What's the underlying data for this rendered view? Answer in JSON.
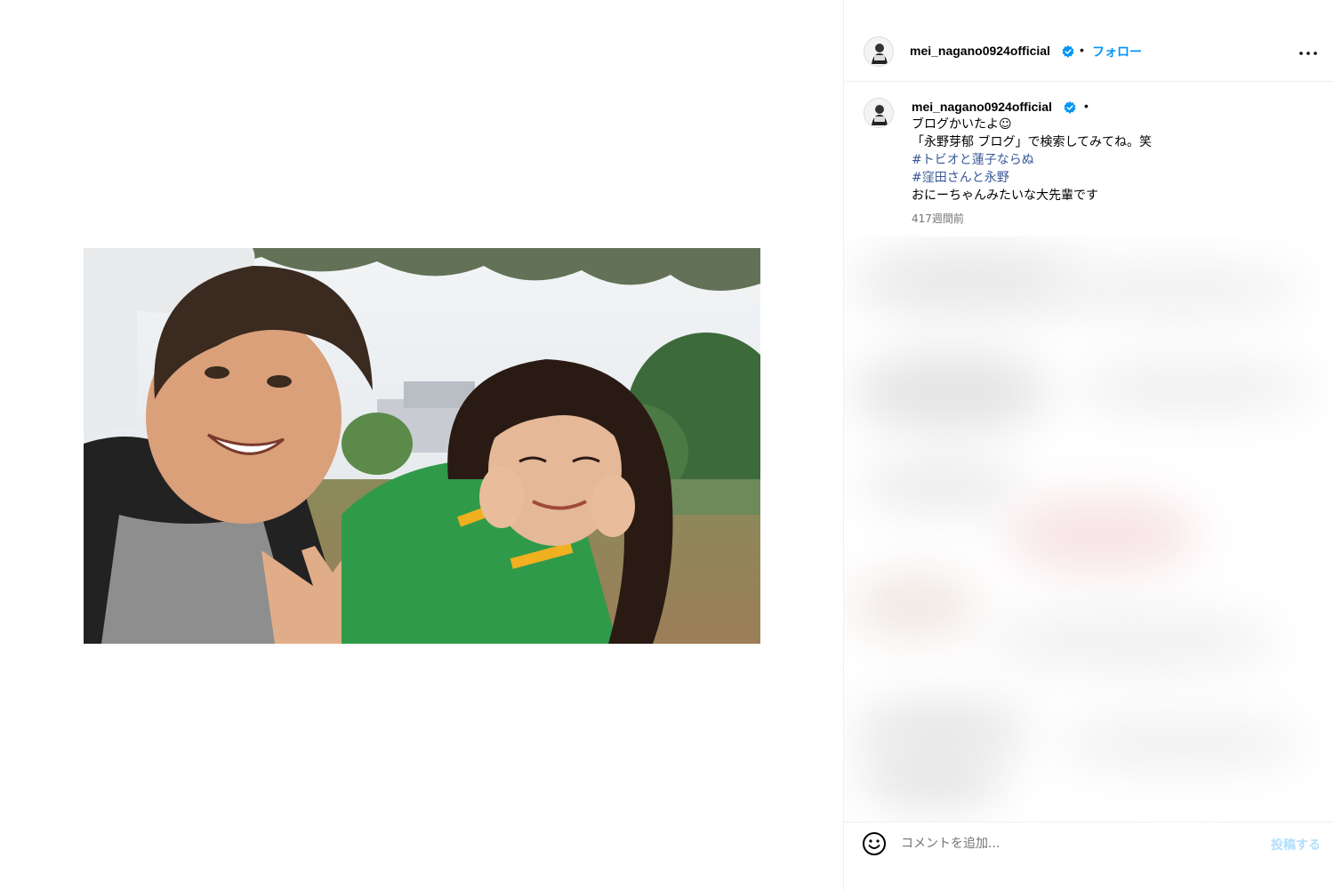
{
  "post": {
    "image_alt": "",
    "header": {
      "username": "mei_nagano0924official",
      "separator": "•",
      "follow_label": "フォロー"
    },
    "caption": {
      "username": "mei_nagano0924official",
      "separator": "•",
      "lines": [
        "ブログかいたよ☺",
        "「永野芽郁 ブログ」で検索してみてね。笑"
      ],
      "hashtags": [
        "#トビオと蓮子ならぬ",
        "#窪田さんと永野"
      ],
      "last_line": "おにーちゃんみたいな大先輩です",
      "timestamp": "417週間前"
    },
    "comment_box": {
      "placeholder": "コメントを追加...",
      "post_label": "投稿する"
    }
  },
  "colors": {
    "accent": "#0095f6",
    "hashtag": "#385898",
    "muted": "#737373",
    "post_disabled": "#b2dffc",
    "verified": "#0095f6"
  },
  "icons": {
    "verified": "verified-badge-icon",
    "more": "more-options-icon",
    "emoji": "emoji-icon"
  }
}
